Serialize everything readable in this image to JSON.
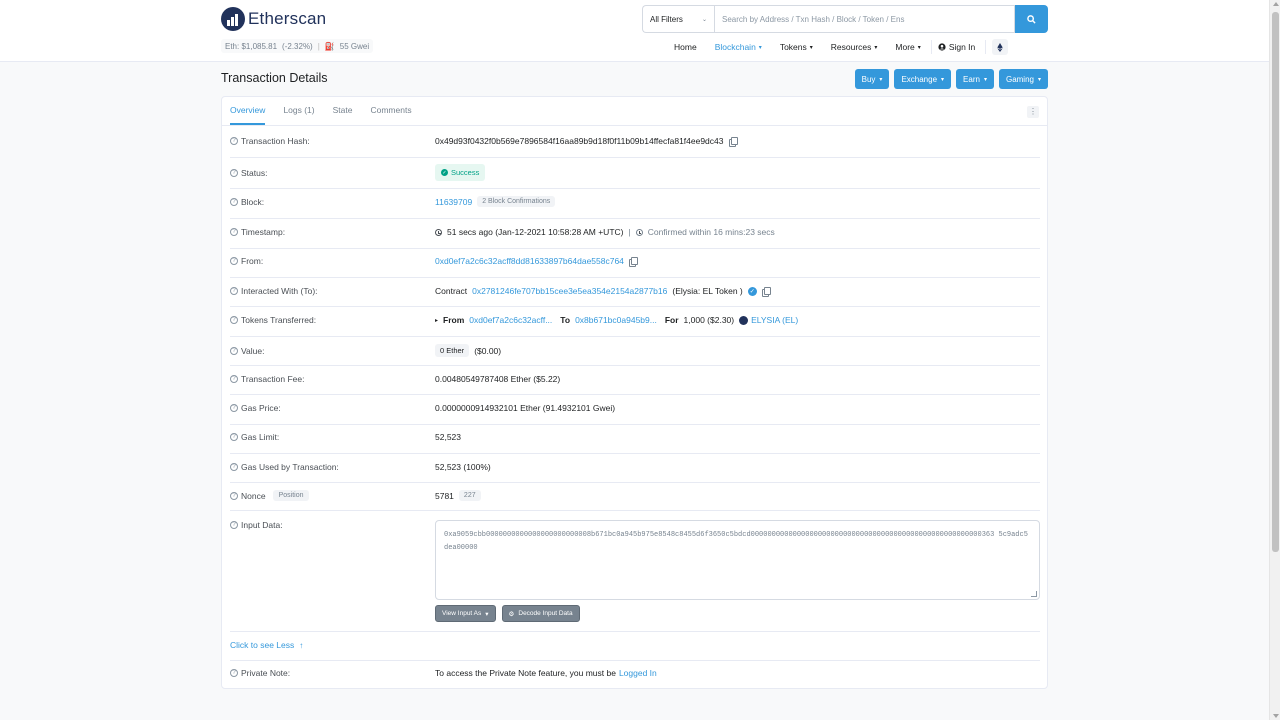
{
  "header": {
    "brand": "Etherscan",
    "eth_price": "Eth: $1,085.81",
    "eth_change": "(-2.32%)",
    "gas": "55 Gwei",
    "filter_selected": "All Filters",
    "search_placeholder": "Search by Address / Txn Hash / Block / Token / Ens",
    "nav": [
      {
        "label": "Home",
        "dropdown": false
      },
      {
        "label": "Blockchain",
        "dropdown": true,
        "active": true
      },
      {
        "label": "Tokens",
        "dropdown": true
      },
      {
        "label": "Resources",
        "dropdown": true
      },
      {
        "label": "More",
        "dropdown": true
      }
    ],
    "sign_in": "Sign In"
  },
  "page": {
    "title": "Transaction Details",
    "buttons": [
      "Buy",
      "Exchange",
      "Earn",
      "Gaming"
    ]
  },
  "tabs": [
    "Overview",
    "Logs (1)",
    "State",
    "Comments"
  ],
  "details": {
    "tx_hash_label": "Transaction Hash:",
    "tx_hash": "0x49d93f0432f0b569e7896584f16aa89b9d18f0f11b09b14ffecfa81f4ee9dc43",
    "status_label": "Status:",
    "status": "Success",
    "block_label": "Block:",
    "block": "11639709",
    "block_confirmations": "2 Block Confirmations",
    "timestamp_label": "Timestamp:",
    "timestamp": "51 secs ago (Jan-12-2021 10:58:28 AM +UTC)",
    "confirmed_within": "Confirmed within 16 mins:23 secs",
    "from_label": "From:",
    "from": "0xd0ef7a2c6c32acff8dd81633897b64dae558c764",
    "interacted_label": "Interacted With (To):",
    "contract_prefix": "Contract",
    "contract_address": "0x2781246fe707bb15cee3e5ea354e2154a2877b16",
    "contract_name": "(Elysia: EL Token )",
    "tokens_label": "Tokens Transferred:",
    "tokens_from_prefix": "From",
    "tokens_from": "0xd0ef7a2c6c32acff...",
    "tokens_to_prefix": "To",
    "tokens_to": "0x8b671bc0a945b9...",
    "tokens_for_prefix": "For",
    "tokens_amount": "1,000 ($2.30)",
    "tokens_name": "ELYSIA (EL)",
    "value_label": "Value:",
    "value_eth": "0 Ether",
    "value_usd": "($0.00)",
    "fee_label": "Transaction Fee:",
    "fee": "0.00480549787408 Ether ($5.22)",
    "gas_price_label": "Gas Price:",
    "gas_price": "0.0000000914932101 Ether (91.4932101 Gwei)",
    "gas_limit_label": "Gas Limit:",
    "gas_limit": "52,523",
    "gas_used_label": "Gas Used by Transaction:",
    "gas_used": "52,523 (100%)",
    "nonce_label": "Nonce",
    "position_tag": "Position",
    "nonce": "5781",
    "position": "227",
    "input_label": "Input Data:",
    "input_data": "0xa9059cbb0000000000000000000000008b671bc0a945b975e8548c8455d6f3650c5bdcd0000000000000000000000000000000000000000000000000000000363 5c9adc5dea00000",
    "view_input_as": "View Input As",
    "decode_input": "Decode Input Data",
    "click_less": "Click to see Less",
    "private_note_label": "Private Note:",
    "private_note_text": "To access the Private Note feature, you must be",
    "logged_in_link": "Logged In"
  },
  "colors": {
    "accent": "#3498db",
    "brand_dark": "#21325b",
    "success": "#00a186"
  }
}
